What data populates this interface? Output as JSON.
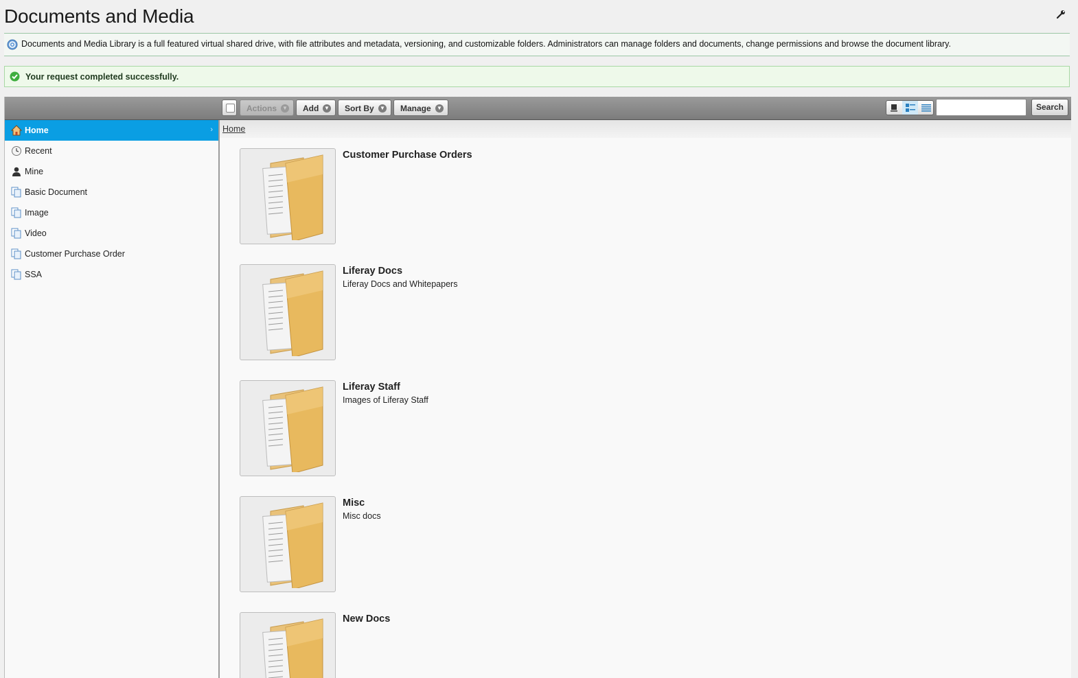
{
  "page": {
    "title": "Documents and Media",
    "info_text": "Documents and Media Library is a full featured virtual shared drive, with file attributes and metadata, versioning, and customizable folders. Administrators can manage folders and documents, change permissions and browse the document library.",
    "success_text": "Your request completed successfully."
  },
  "sidebar": {
    "items": [
      {
        "label": "Home",
        "icon": "home-icon",
        "active": true
      },
      {
        "label": "Recent",
        "icon": "clock-icon"
      },
      {
        "label": "Mine",
        "icon": "user-icon"
      },
      {
        "label": "Basic Document",
        "icon": "document-type-icon"
      },
      {
        "label": "Image",
        "icon": "document-type-icon"
      },
      {
        "label": "Video",
        "icon": "document-type-icon"
      },
      {
        "label": "Customer Purchase Order",
        "icon": "document-type-icon"
      },
      {
        "label": "SSA",
        "icon": "document-type-icon"
      }
    ],
    "active_chevron": "›"
  },
  "toolbar": {
    "actions_label": "Actions",
    "add_label": "Add",
    "sort_by_label": "Sort By",
    "manage_label": "Manage",
    "search_placeholder": "",
    "search_value": "",
    "search_button_label": "Search",
    "view_modes": [
      "icon-view",
      "descriptive-view",
      "list-view"
    ],
    "selected_view": "descriptive-view"
  },
  "breadcrumb": {
    "items": [
      "Home"
    ]
  },
  "folders": [
    {
      "title": "Customer Purchase Orders",
      "description": ""
    },
    {
      "title": "Liferay Docs",
      "description": "Liferay Docs and Whitepapers"
    },
    {
      "title": "Liferay Staff",
      "description": "Images of Liferay Staff"
    },
    {
      "title": "Misc",
      "description": "Misc docs"
    },
    {
      "title": "New Docs",
      "description": ""
    }
  ],
  "colors": {
    "accent": "#0a9ee3",
    "success_bg": "#eef9ea",
    "toolbar_bg": "#8a8a8a",
    "folder": "#e8b95e"
  }
}
